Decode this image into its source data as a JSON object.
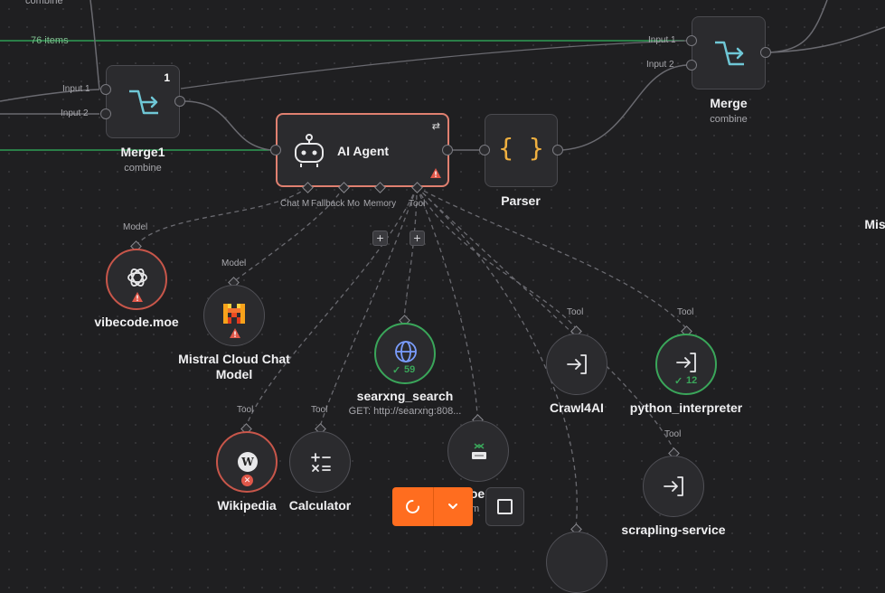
{
  "canvas": {
    "top_left_partial": "combine",
    "edge_items": "76 items",
    "right_cut_label": "Mis"
  },
  "merge1": {
    "title": "Merge1",
    "subtitle": "combine",
    "badge": "1",
    "input1": "Input 1",
    "input2": "Input 2",
    "icon": "merge-arrow-icon"
  },
  "merge": {
    "title": "Merge",
    "subtitle": "combine",
    "input1": "Input 1",
    "input2": "Input 2",
    "icon": "merge-arrow-icon"
  },
  "agent": {
    "title": "AI Agent",
    "icon": "robot-icon",
    "ports": [
      "Chat M",
      "Fallback Mo",
      "Memory",
      "Tool"
    ]
  },
  "parser": {
    "title": "Parser",
    "icon": "braces-icon"
  },
  "subnodes": {
    "vibecode": {
      "title": "vibecode.moe",
      "port": "Model",
      "icon": "openai-icon"
    },
    "mistral": {
      "title_line1": "Mistral Cloud Chat",
      "title_line2": "Model",
      "port": "Model",
      "icon": "mistral-icon"
    },
    "searxng": {
      "title": "searxng_search",
      "subtitle": "GET: http://searxng:808...",
      "port": "",
      "count": "59",
      "icon": "globe-icon"
    },
    "crawl4ai": {
      "title": "Crawl4AI",
      "port": "Tool",
      "icon": "tool-enter-icon"
    },
    "python": {
      "title": "python_interpreter",
      "port": "Tool",
      "count": "12",
      "icon": "tool-enter-icon"
    },
    "wikipedia": {
      "title": "Wikipedia",
      "port": "Tool",
      "icon": "wikipedia-icon"
    },
    "calculator": {
      "title": "Calculator",
      "port": "Tool",
      "icon": "calculator-icon"
    },
    "docling": {
      "title": "oe",
      "subtitle": ".m",
      "icon": "document-icon"
    },
    "scrapling": {
      "title": "scrapling-service",
      "port": "Tool",
      "icon": "tool-enter-icon"
    }
  },
  "toolbar": {
    "run_icon": "spinner-icon",
    "dropdown_icon": "chevron-down-icon",
    "stop_icon": "stop-square-icon"
  },
  "colors": {
    "accent": "#ff6d1f",
    "agent_border": "#e08070",
    "success": "#3aa65a",
    "error": "#e0584a",
    "canvas": "#1f1f21"
  }
}
